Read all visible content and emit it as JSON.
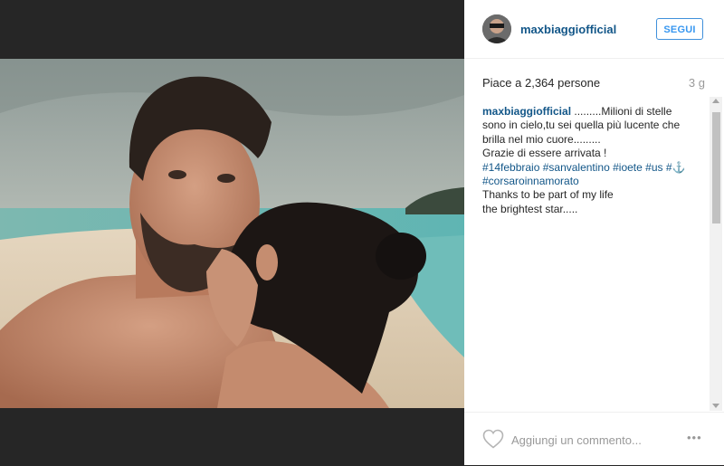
{
  "post": {
    "username": "maxbiaggiofficial",
    "follow_label": "SEGUI",
    "likes": "Piace a 2,364 persone",
    "age": "3 g"
  },
  "caption": {
    "username": "maxbiaggiofficial",
    "line1": " .........Milioni di stelle",
    "line2": "sono in cielo,tu sei quella più lucente che",
    "line3": "brilla nel mio cuore.........",
    "line4": "Grazie di essere arrivata !",
    "tags1": "#14febbraio #sanvalentino #ioete #us #⚓",
    "tags2": "#corsaroinnamorato",
    "line5": "Thanks to be part of my life",
    "line6": "the brightest star....."
  },
  "comment": {
    "placeholder": "Aggiungi un commento..."
  },
  "icons": {
    "like": "heart-icon",
    "more": "more-options-icon"
  },
  "colors": {
    "username": "#125688",
    "follow": "#3897f0",
    "media_bg": "#262626"
  }
}
